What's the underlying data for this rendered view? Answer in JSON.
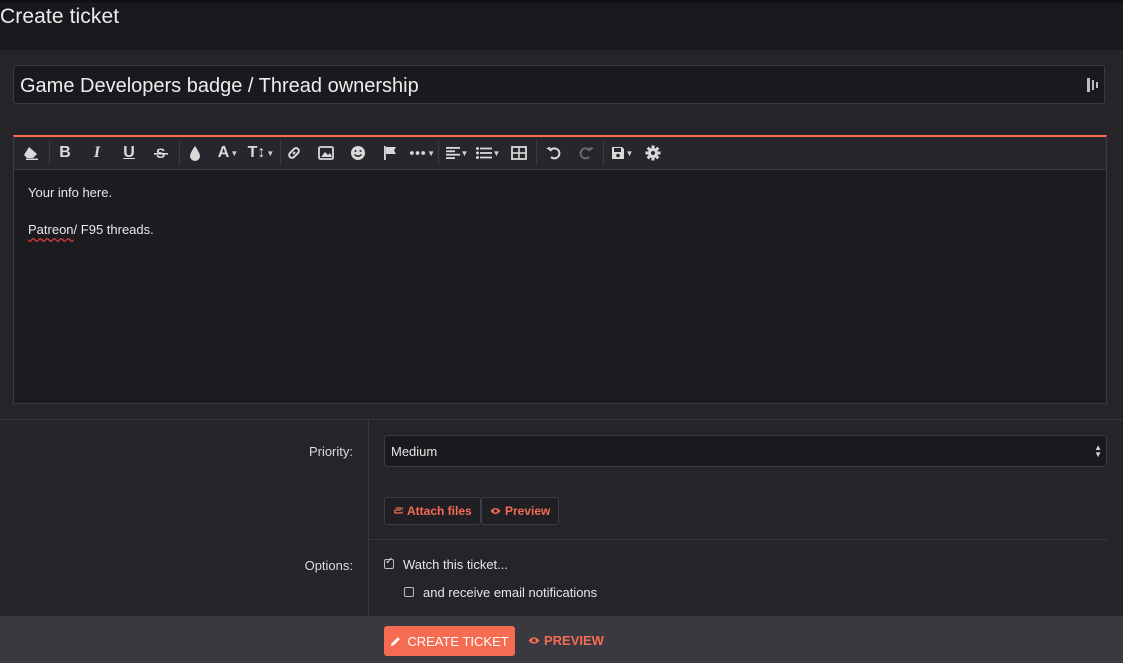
{
  "header": {
    "title": "Create ticket"
  },
  "ticket": {
    "title_value": "Game Developers badge / Thread ownership"
  },
  "toolbar": {
    "items": [
      "eraser-icon",
      "bold-icon",
      "italic-icon",
      "underline-icon",
      "strikethrough-icon",
      "color-icon",
      "font-family-icon",
      "font-size-icon",
      "link-icon",
      "image-icon",
      "smiley-icon",
      "flag-icon",
      "more-icon",
      "align-icon",
      "list-icon",
      "table-icon",
      "undo-icon",
      "redo-icon",
      "drafts-icon",
      "settings-icon"
    ],
    "bold_label": "B",
    "italic_label": "I",
    "underline_label": "U",
    "font_label": "A",
    "size_label": "T↕"
  },
  "editor": {
    "line1": "Your info here.",
    "line2_word": "Patreon",
    "line2_rest": "/ F95 threads."
  },
  "form": {
    "priority_label": "Priority:",
    "priority_value": "Medium",
    "attach_label": "Attach files",
    "preview_label": "Preview",
    "options_label": "Options:",
    "watch_label": "Watch this ticket...",
    "watch_checked": true,
    "email_label": "and receive email notifications",
    "email_checked": false
  },
  "footer": {
    "create_label": "CREATE TICKET",
    "preview_label": "PREVIEW"
  },
  "colors": {
    "accent": "#f56c52",
    "background": "#242429",
    "header": "#18181d",
    "footer": "#39393f"
  }
}
